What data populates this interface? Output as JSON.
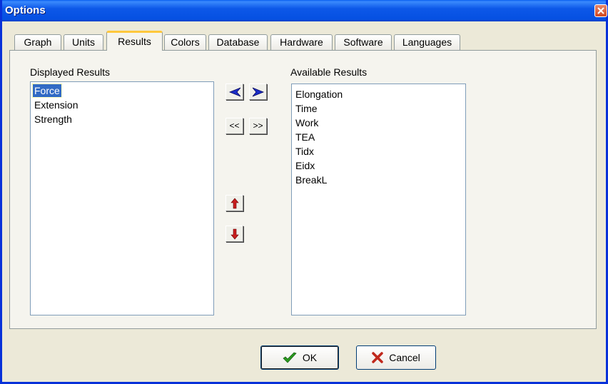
{
  "window": {
    "title": "Options"
  },
  "tabs": [
    {
      "label": "Graph"
    },
    {
      "label": "Units"
    },
    {
      "label": "Results"
    },
    {
      "label": "Colors"
    },
    {
      "label": "Database"
    },
    {
      "label": "Hardware"
    },
    {
      "label": "Software"
    },
    {
      "label": "Languages"
    }
  ],
  "active_tab": "Results",
  "displayed": {
    "label": "Displayed Results",
    "items": [
      "Force",
      "Extension",
      "Strength"
    ],
    "selected": "Force"
  },
  "available": {
    "label": "Available Results",
    "items": [
      "Elongation",
      "Time",
      "Work",
      "TEA",
      "Tidx",
      "Eidx",
      "BreakL"
    ]
  },
  "transfer": {
    "move_all_left": "<<",
    "move_all_right": ">>"
  },
  "footer": {
    "ok_label": "OK",
    "cancel_label": "Cancel"
  },
  "colors": {
    "titlebar": "#0550E2",
    "selection": "#316AC5",
    "arrow_blue": "#1A2DC8",
    "arrow_red": "#C81E1E",
    "ok_check": "#2A9A1E",
    "cancel_x": "#C0281C"
  },
  "icons": {
    "left": "arrow-left-icon",
    "right": "arrow-right-icon",
    "up": "arrow-up-icon",
    "down": "arrow-down-icon",
    "ok": "check-icon",
    "cancel": "x-icon"
  }
}
